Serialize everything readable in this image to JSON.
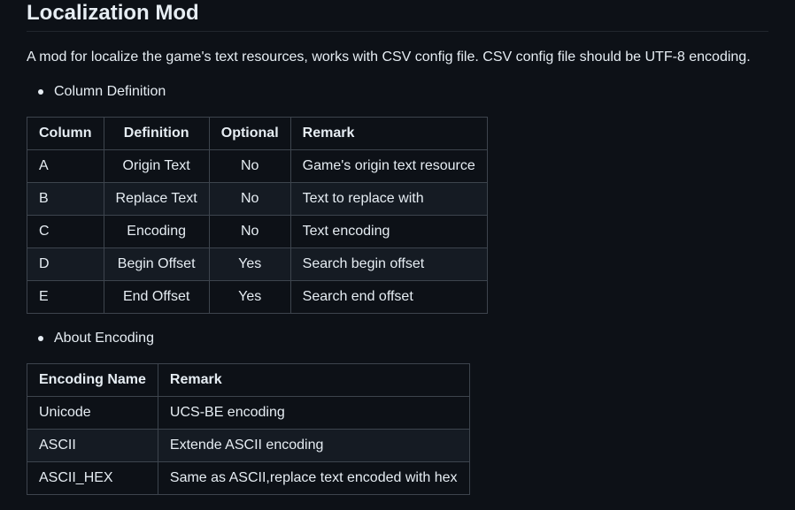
{
  "heading": "Localization Mod",
  "description": "A mod for localize the game's text resources, works with CSV config file. CSV config file should be UTF-8 encoding.",
  "sections": [
    {
      "bullet": "Column Definition"
    },
    {
      "bullet": "About Encoding"
    }
  ],
  "column_table": {
    "headers": [
      "Column",
      "Definition",
      "Optional",
      "Remark"
    ],
    "rows": [
      [
        "A",
        "Origin Text",
        "No",
        "Game's origin text resource"
      ],
      [
        "B",
        "Replace Text",
        "No",
        "Text to replace with"
      ],
      [
        "C",
        "Encoding",
        "No",
        "Text encoding"
      ],
      [
        "D",
        "Begin Offset",
        "Yes",
        "Search begin offset"
      ],
      [
        "E",
        "End Offset",
        "Yes",
        "Search end offset"
      ]
    ]
  },
  "encoding_table": {
    "headers": [
      "Encoding Name",
      "Remark"
    ],
    "rows": [
      [
        "Unicode",
        "UCS-BE encoding"
      ],
      [
        "ASCII",
        "Extende ASCII encoding"
      ],
      [
        "ASCII_HEX",
        "Same as ASCII,replace text encoded with hex"
      ]
    ]
  }
}
